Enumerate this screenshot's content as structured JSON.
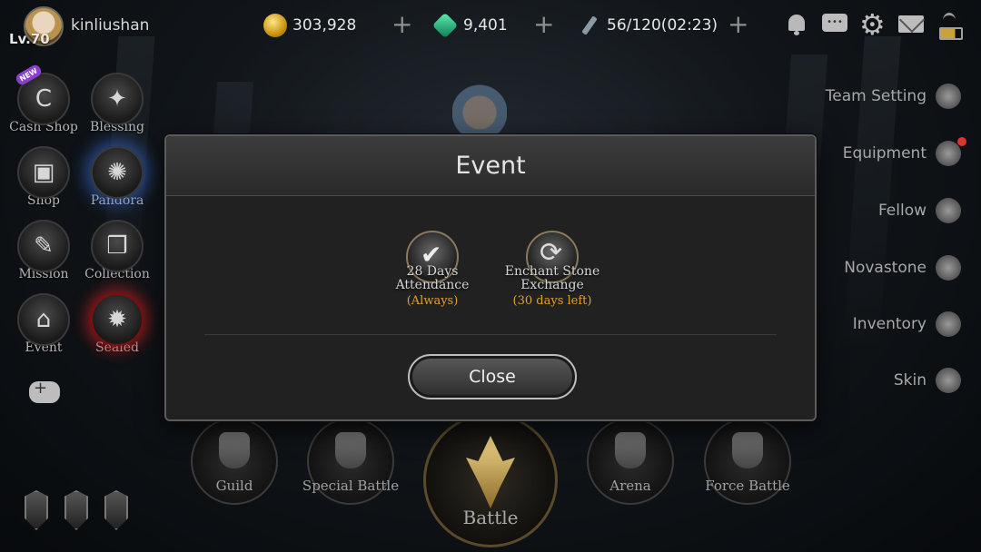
{
  "player": {
    "level": "Lv.70",
    "name": "kinliushan"
  },
  "resources": {
    "gold": "303,928",
    "gems": "9,401",
    "stamina": "56/120(02:23)"
  },
  "left_menu": [
    {
      "label": "Cash Shop",
      "badge": "NEW",
      "icon": "cash-shop-icon"
    },
    {
      "label": "Blessing",
      "icon": "blessing-icon"
    },
    {
      "label": "Shop",
      "icon": "chest-icon"
    },
    {
      "label": "Pandora",
      "icon": "pandora-icon"
    },
    {
      "label": "Mission",
      "icon": "scroll-icon"
    },
    {
      "label": "Collection",
      "icon": "book-icon"
    },
    {
      "label": "Event",
      "icon": "gift-icon"
    },
    {
      "label": "Sealed",
      "icon": "seal-icon"
    }
  ],
  "right_menu": [
    {
      "label": "Team Setting"
    },
    {
      "label": "Equipment"
    },
    {
      "label": "Fellow"
    },
    {
      "label": "Novastone"
    },
    {
      "label": "Inventory"
    },
    {
      "label": "Skin"
    }
  ],
  "bottom_menu": {
    "guild": "Guild",
    "special_battle": "Special Battle",
    "battle": "Battle",
    "arena": "Arena",
    "force_battle": "Force Battle"
  },
  "modal": {
    "title": "Event",
    "events": [
      {
        "name": "28 Days Attendance",
        "sub": "(Always)"
      },
      {
        "name": "Enchant Stone Exchange",
        "sub": "(30 days left)"
      }
    ],
    "close_label": "Close"
  },
  "colors": {
    "accent_gold": "#e0a030",
    "alert_red": "#e03030"
  }
}
